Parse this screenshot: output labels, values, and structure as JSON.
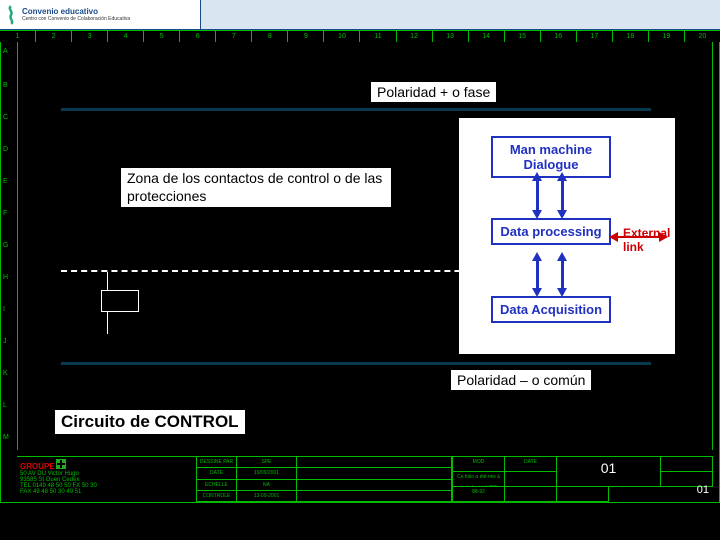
{
  "header": {
    "brand_top": "Convenio educativo",
    "brand_sub": "Centro con Convenio de Colaboración Educativa"
  },
  "ruler": {
    "cols": [
      "1",
      "2",
      "3",
      "4",
      "5",
      "6",
      "7",
      "8",
      "9",
      "10",
      "11",
      "12",
      "13",
      "14",
      "15",
      "16",
      "17",
      "18",
      "19",
      "20"
    ]
  },
  "rows": [
    "A",
    "B",
    "C",
    "D",
    "E",
    "F",
    "G",
    "H",
    "I",
    "J",
    "K",
    "L",
    "M"
  ],
  "labels": {
    "polarity_pos": "Polaridad + o fase",
    "zona": "Zona de los contactos de control o de las protecciones",
    "polarity_neg": "Polaridad – o común",
    "circuito": "Circuito de CONTROL"
  },
  "block_diagram": {
    "mmd": "Man machine Dialogue",
    "dp": "Data processing",
    "da": "Data Acquisition",
    "ext": "External link"
  },
  "titleblock": {
    "groupe": "GROUPE",
    "addr1": "50 AV DU Victor Hugo",
    "addr2": "93585 St Ouen Cedex",
    "tel": "TEL 0149 48 50 50 FX 50 30",
    "fax": "FAX 49 48 50 30 49 51",
    "col_a": "DESSINE PAR",
    "col_b": "DATE",
    "col_c": "ECHELLE",
    "val_a": "SPE",
    "val_b": "19/09/2001",
    "val_c": "NA",
    "col_d": "CONTROLE PAR",
    "val_d": "13-09-2001",
    "right_a": "MOD",
    "right_b": "DATE",
    "right_c": "Ce folio a été mis à jour le logiciel IGE+",
    "right_d": "88-92",
    "page": "01"
  }
}
